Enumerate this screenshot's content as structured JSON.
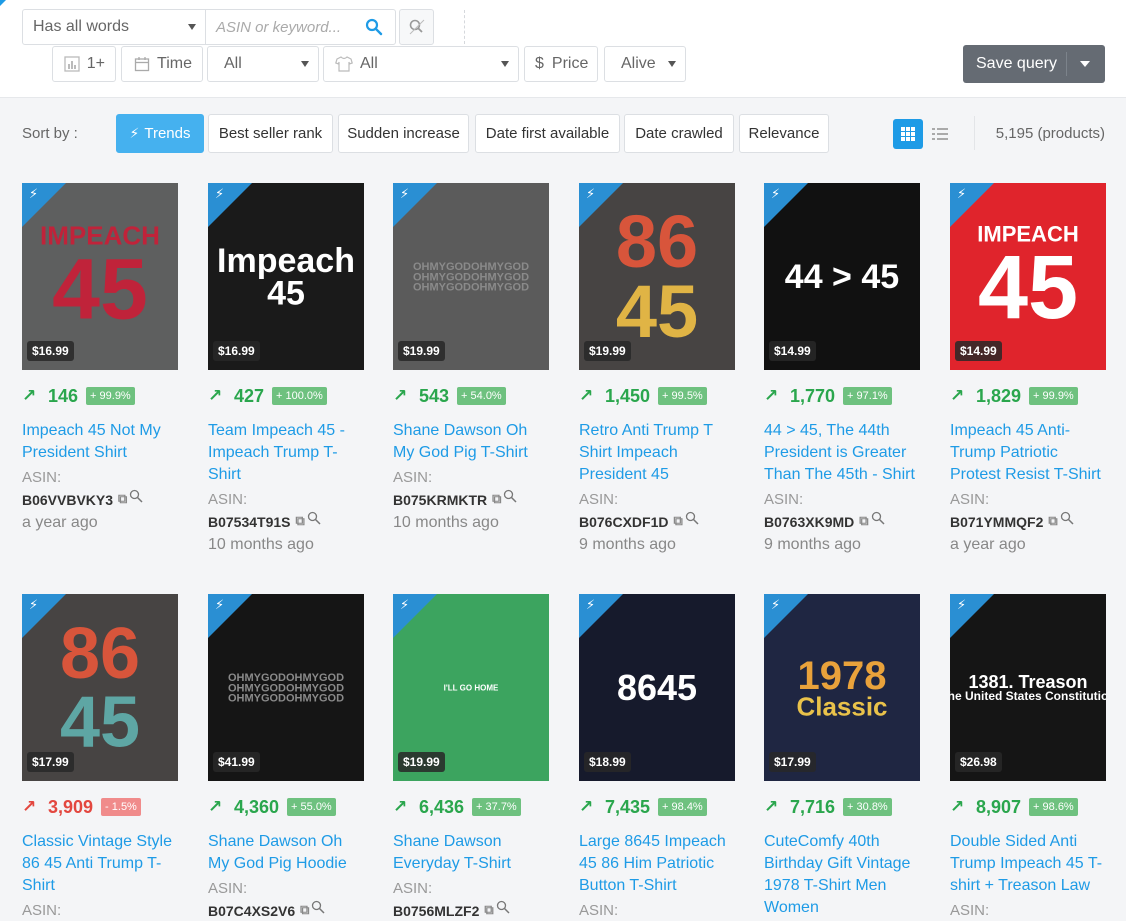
{
  "search": {
    "match_mode": "Has all words",
    "placeholder": "ASIN or keyword...",
    "search_icon": "search-icon",
    "clear_icon": "search-clear-icon"
  },
  "filters": {
    "rank_value": "1+",
    "time_label": "Time",
    "category_value": "All",
    "type_value": "All",
    "price_label": "Price",
    "price_symbol": "$",
    "status_value": "Alive"
  },
  "save_query_label": "Save query",
  "sort": {
    "label": "Sort by :",
    "options": [
      "Trends",
      "Best seller rank",
      "Sudden increase",
      "Date first available",
      "Date crawled",
      "Relevance"
    ],
    "active": "Trends"
  },
  "product_count": "5,195 (products)",
  "labels": {
    "asin": "ASIN:"
  },
  "colors": {
    "accent": "#1e9be6",
    "positive": "#2aa64d",
    "negative": "#e3473f",
    "save_bg": "#656b73"
  },
  "products": [
    {
      "price": "$16.99",
      "rank": "146",
      "change": "+ 99.9%",
      "trend": "up",
      "title": "Impeach 45 Not My President Shirt",
      "asin": "B06VVBVKY3",
      "date": "a year ago"
    },
    {
      "price": "$16.99",
      "rank": "427",
      "change": "+ 100.0%",
      "trend": "up",
      "title": "Team Impeach 45 - Impeach Trump T-Shirt",
      "asin": "B07534T91S",
      "date": "10 months ago"
    },
    {
      "price": "$19.99",
      "rank": "543",
      "change": "+ 54.0%",
      "trend": "up",
      "title": "Shane Dawson Oh My God Pig T-Shirt",
      "asin": "B075KRMKTR",
      "date": "10 months ago"
    },
    {
      "price": "$19.99",
      "rank": "1,450",
      "change": "+ 99.5%",
      "trend": "up",
      "title": "Retro Anti Trump T Shirt Impeach President 45",
      "asin": "B076CXDF1D",
      "date": "9 months ago"
    },
    {
      "price": "$14.99",
      "rank": "1,770",
      "change": "+ 97.1%",
      "trend": "up",
      "title": "44 > 45, The 44th President is Greater Than The 45th - Shirt",
      "asin": "B0763XK9MD",
      "date": "9 months ago"
    },
    {
      "price": "$14.99",
      "rank": "1,829",
      "change": "+ 99.9%",
      "trend": "up",
      "title": "Impeach 45 Anti-Trump Patriotic Protest Resist T-Shirt",
      "asin": "B071YMMQF2",
      "date": "a year ago"
    },
    {
      "price": "$17.99",
      "rank": "3,909",
      "change": "- 1.5%",
      "trend": "down",
      "title": "Classic Vintage Style 86 45 Anti Trump T-Shirt",
      "asin": "",
      "date": ""
    },
    {
      "price": "$41.99",
      "rank": "4,360",
      "change": "+ 55.0%",
      "trend": "up",
      "title": "Shane Dawson Oh My God Pig Hoodie",
      "asin": "B07C4XS2V6",
      "date": ""
    },
    {
      "price": "$19.99",
      "rank": "6,436",
      "change": "+ 37.7%",
      "trend": "up",
      "title": "Shane Dawson Everyday T-Shirt",
      "asin": "B0756MLZF2",
      "date": ""
    },
    {
      "price": "$18.99",
      "rank": "7,435",
      "change": "+ 98.4%",
      "trend": "up",
      "title": "Large 8645 Impeach 45 86 Him Patriotic Button T-Shirt",
      "asin": "",
      "date": ""
    },
    {
      "price": "$17.99",
      "rank": "7,716",
      "change": "+ 30.8%",
      "trend": "up",
      "title": "CuteComfy 40th Birthday Gift Vintage 1978 T-Shirt Men Women",
      "asin": "",
      "date": ""
    },
    {
      "price": "$26.98",
      "rank": "8,907",
      "change": "+ 98.6%",
      "trend": "up",
      "title": "Double Sided Anti Trump Impeach 45 T-shirt + Treason Law",
      "asin": "",
      "date": ""
    }
  ],
  "artwork": [
    {
      "bg": "#5e5f5f",
      "lines": [
        {
          "t": "IMPEACH",
          "c": "#c0233a",
          "s": 26
        },
        {
          "t": "45",
          "c": "#c0233a",
          "s": 86
        }
      ]
    },
    {
      "bg": "#1a1a1a",
      "lines": [
        {
          "t": "Impeach",
          "c": "#ffffff",
          "s": 34
        },
        {
          "t": "45",
          "c": "#ffffff",
          "s": 34
        }
      ]
    },
    {
      "bg": "#5b5b5b",
      "lines": [
        {
          "t": "OHMYGODOHMYGOD",
          "c": "#8a8a8a",
          "s": 11
        },
        {
          "t": "OHMYGODOHMYGOD",
          "c": "#8a8a8a",
          "s": 11
        },
        {
          "t": "OHMYGODOHMYGOD",
          "c": "#8a8a8a",
          "s": 11
        }
      ]
    },
    {
      "bg": "#474443",
      "lines": [
        {
          "t": "86",
          "c": "#d8553b",
          "s": 74
        },
        {
          "t": "45",
          "c": "#e0b445",
          "s": 74
        }
      ]
    },
    {
      "bg": "#111111",
      "lines": [
        {
          "t": "44 > 45",
          "c": "#ffffff",
          "s": 34
        }
      ]
    },
    {
      "bg": "#e0242c",
      "lines": [
        {
          "t": "IMPEACH",
          "c": "#ffffff",
          "s": 22
        },
        {
          "t": "45",
          "c": "#ffffff",
          "s": 90
        }
      ]
    },
    {
      "bg": "#474443",
      "lines": [
        {
          "t": "86",
          "c": "#d8553b",
          "s": 72
        },
        {
          "t": "45",
          "c": "#5ea6a4",
          "s": 72
        }
      ]
    },
    {
      "bg": "#151515",
      "lines": [
        {
          "t": "OHMYGODOHMYGOD",
          "c": "#8a8a8a",
          "s": 11
        },
        {
          "t": "OHMYGODOHMYGOD",
          "c": "#8a8a8a",
          "s": 11
        },
        {
          "t": "OHMYGODOHMYGOD",
          "c": "#8a8a8a",
          "s": 11
        }
      ]
    },
    {
      "bg": "#3ca45f",
      "lines": [
        {
          "t": "I'LL GO HOME",
          "c": "#ffffff",
          "s": 8
        }
      ]
    },
    {
      "bg": "#161a2c",
      "lines": [
        {
          "t": "8645",
          "c": "#ffffff",
          "s": 36
        }
      ]
    },
    {
      "bg": "#1f2642",
      "lines": [
        {
          "t": "1978",
          "c": "#e9a23b",
          "s": 40
        },
        {
          "t": "Classic",
          "c": "#e9c24a",
          "s": 26
        }
      ]
    },
    {
      "bg": "#151515",
      "lines": [
        {
          "t": "1381. Treason",
          "c": "#ffffff",
          "s": 18
        },
        {
          "t": "The United States Constitution",
          "c": "#ffffff",
          "s": 12
        }
      ]
    }
  ]
}
